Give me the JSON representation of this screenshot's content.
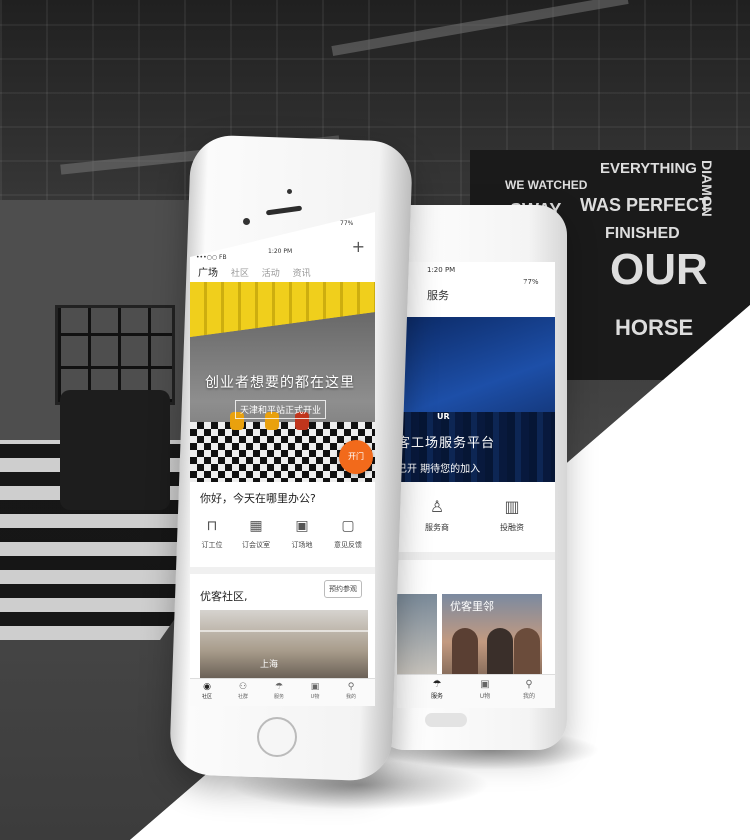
{
  "front_phone": {
    "status": {
      "carrier": "•••○○ FB",
      "time": "1:20 PM",
      "battery": "77%"
    },
    "top_nav": [
      {
        "label": "广场",
        "active": true
      },
      {
        "label": "社区",
        "active": false
      },
      {
        "label": "活动",
        "active": false
      },
      {
        "label": "资讯",
        "active": false
      }
    ],
    "add_icon": "+",
    "hero": {
      "headline": "创业者想要的都在这里",
      "subline": "天津和平站正式开业"
    },
    "open_button": "开门",
    "greeting": "你好，今天在哪里办公?",
    "quick_actions": [
      {
        "icon": "desk-icon",
        "glyph": "⊓",
        "label": "订工位"
      },
      {
        "icon": "meeting-room-icon",
        "glyph": "▦",
        "label": "订会议室"
      },
      {
        "icon": "venue-icon",
        "glyph": "▣",
        "label": "订场地"
      },
      {
        "icon": "feedback-icon",
        "glyph": "▢",
        "label": "意见反馈"
      }
    ],
    "community": {
      "title": "优客社区,",
      "visit_button": "预约参观",
      "card_city": "上海"
    },
    "tabs": [
      {
        "icon": "community-icon",
        "glyph": "◉",
        "label": "社区",
        "active": true
      },
      {
        "icon": "social-icon",
        "glyph": "⚇",
        "label": "社群",
        "active": false
      },
      {
        "icon": "service-icon",
        "glyph": "☂",
        "label": "服务",
        "active": false
      },
      {
        "icon": "ugift-icon",
        "glyph": "▣",
        "label": "U物",
        "active": false
      },
      {
        "icon": "me-icon",
        "glyph": "⚲",
        "label": "我的",
        "active": false
      }
    ]
  },
  "back_phone": {
    "status": {
      "time": "1:20 PM",
      "battery": "77%"
    },
    "title": "服务",
    "hero": {
      "logo": "UR",
      "headline": "客工场服务平台",
      "subline": "已开  期待您的加入"
    },
    "services": [
      {
        "icon": "tie-icon",
        "glyph": "♙",
        "label": "服务商"
      },
      {
        "icon": "investment-icon",
        "glyph": "▥",
        "label": "投融资"
      }
    ],
    "card_label": "优客里邻",
    "tabs": [
      {
        "icon": "service-icon",
        "glyph": "☂",
        "label": "服务",
        "active": true
      },
      {
        "icon": "ugift-icon",
        "glyph": "▣",
        "label": "U物",
        "active": false
      },
      {
        "icon": "me-icon",
        "glyph": "⚲",
        "label": "我的",
        "active": false
      }
    ]
  },
  "background": {
    "wall_text": [
      "WE WATCHED",
      "EVERYTHING",
      "SWAY",
      "WAS PERFECT",
      "FINISHED",
      "OUR",
      "HORSE",
      "DIAMON"
    ]
  }
}
